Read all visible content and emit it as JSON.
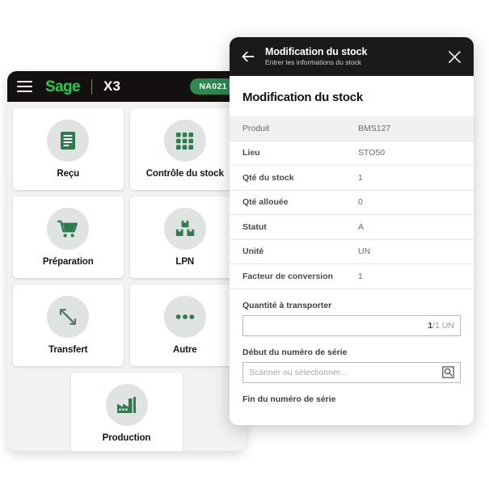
{
  "app": {
    "menu_icon": "hamburger-icon",
    "logo_text": "Sage",
    "product_label": "X3",
    "site_badge": "NA021",
    "accent_green": "#21d04b",
    "badge_green": "#2c8a4e",
    "icon_green": "#317a4e",
    "header_black": "#14100f",
    "tiles": [
      {
        "label": "Reçu",
        "icon": "document-receipt-icon"
      },
      {
        "label": "Contrôle du stock",
        "icon": "grid-nine-squares-icon"
      },
      {
        "label": "Préparation",
        "icon": "shopping-cart-icon"
      },
      {
        "label": "LPN",
        "icon": "stacked-boxes-icon"
      },
      {
        "label": "Transfert",
        "icon": "transfer-arrows-icon"
      },
      {
        "label": "Autre",
        "icon": "ellipsis-icon"
      },
      {
        "label": "Production",
        "icon": "factory-icon"
      }
    ]
  },
  "modal": {
    "header": {
      "back_icon": "back-arrow-icon",
      "title": "Modification du stock",
      "subtitle": "Entrer les informations du stock",
      "close_icon": "close-icon"
    },
    "page_title": "Modification du stock",
    "info_rows": [
      {
        "label": "Produit",
        "value": "BMS127"
      },
      {
        "label": "Lieu",
        "value": "STO50"
      },
      {
        "label": "Qté du stock",
        "value": "1"
      },
      {
        "label": "Qté allouée",
        "value": "0"
      },
      {
        "label": "Statut",
        "value": "A"
      },
      {
        "label": "Unité",
        "value": "UN"
      },
      {
        "label": "Facteur de conversion",
        "value": "1"
      }
    ],
    "fields": {
      "quantity_label": "Quantité à transporter",
      "quantity_value": "",
      "quantity_suffix_strong": "1",
      "quantity_suffix_rest": "/1 UN",
      "serial_start_label": "Début du numéro de série",
      "serial_start_placeholder": "Scanner ou sélectionner...",
      "serial_search_icon": "search-icon",
      "serial_end_label": "Fin du numéro de série"
    }
  }
}
